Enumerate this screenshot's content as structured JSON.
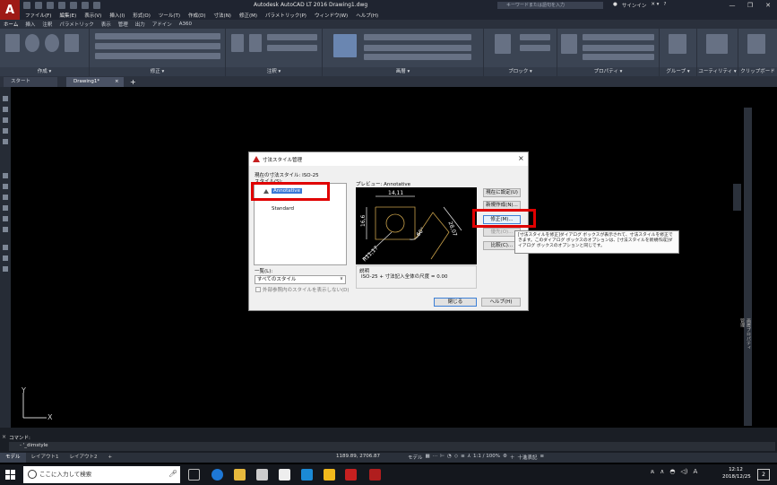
{
  "titlebar": {
    "logo": "A",
    "title": "Autodesk AutoCAD LT 2016   Drawing1.dwg",
    "search_placeholder": "キーワードまたは語句を入力",
    "sign_in": "サインイン",
    "help": "?"
  },
  "menubar": {
    "items": [
      "ファイル(F)",
      "編集(E)",
      "表示(V)",
      "挿入(I)",
      "形式(O)",
      "ツール(T)",
      "作成(D)",
      "寸法(N)",
      "修正(M)",
      "パラメトリック(P)",
      "ウィンドウ(W)",
      "ヘルプ(H)"
    ]
  },
  "ribbon_tabs": {
    "items": [
      "ホーム",
      "挿入",
      "注釈",
      "パラメトリック",
      "表示",
      "管理",
      "出力",
      "アドイン",
      "A360"
    ]
  },
  "ribbon_panels": {
    "draw": "作成 ▾",
    "modify": "修正 ▾",
    "annotation": "注釈 ▾",
    "layers": "画層 ▾",
    "block": "ブロック ▾",
    "properties": "プロパティ ▾",
    "groups": "グループ ▾",
    "utilities": "ユーティリティ ▾",
    "clipboard": "クリップボード"
  },
  "doc_tabs": {
    "start": "スタート",
    "drawing": "Drawing1*",
    "close": "×",
    "add": "+"
  },
  "dialog": {
    "title": "寸法スタイル管理",
    "close": "×",
    "current_style": "現在の寸法スタイル: ISO-25",
    "styles_label": "スタイル(S):",
    "styles": [
      "Annotative",
      "Standard"
    ],
    "list_label": "一覧(L):",
    "list_value": "すべてのスタイル",
    "xref_label": "外部参照内のスタイルを表示しない(D)",
    "preview_label": "プレビュー: Annotative",
    "description_label": "説明",
    "description_text": "ISO-25 + 寸法記入全体の尺度 = 0.00",
    "buttons": {
      "set_current": "現在に設定(U)",
      "new": "新規作成(N)...",
      "modify": "修正(M)...",
      "override": "優先(O)...",
      "compare": "比較(C)...",
      "close": "閉じる",
      "help": "ヘルプ(H)"
    },
    "preview_dims": [
      "14,11",
      "16,6",
      "60°",
      "28,07",
      "R11,17"
    ]
  },
  "tooltip": {
    "text": "[寸法スタイルを修正]ダイアログ ボックスが表示されて、寸法スタイルを修正できます。このダイアログ ボックスのオプションは、[寸法スタイルを新規作成]ダイアログ ボックスのオプションと同じです。"
  },
  "command": {
    "label": "コマンド:",
    "input": "- '_dimstyle",
    "close": "×"
  },
  "status": {
    "layout_tabs": [
      "モデル",
      "レイアウト1",
      "レイアウト2",
      "+"
    ],
    "coords": "1189.89, 2706.87",
    "model": "モデル",
    "scale": "1:1 / 100%",
    "decimal": "十進表記"
  },
  "right_palette": {
    "label": "画層プロパティ管理"
  },
  "taskbar": {
    "search_placeholder": "ここに入力して検索",
    "time": "12:12",
    "date": "2018/12/25",
    "ime": "A",
    "badge": "2"
  },
  "ucs": {
    "x": "X",
    "y": "Y"
  },
  "colors": {
    "highlight": "#e00000",
    "autocad_red": "#9e1a16",
    "selection": "#3b79d6",
    "preview_geometry": "#c8a04a"
  }
}
